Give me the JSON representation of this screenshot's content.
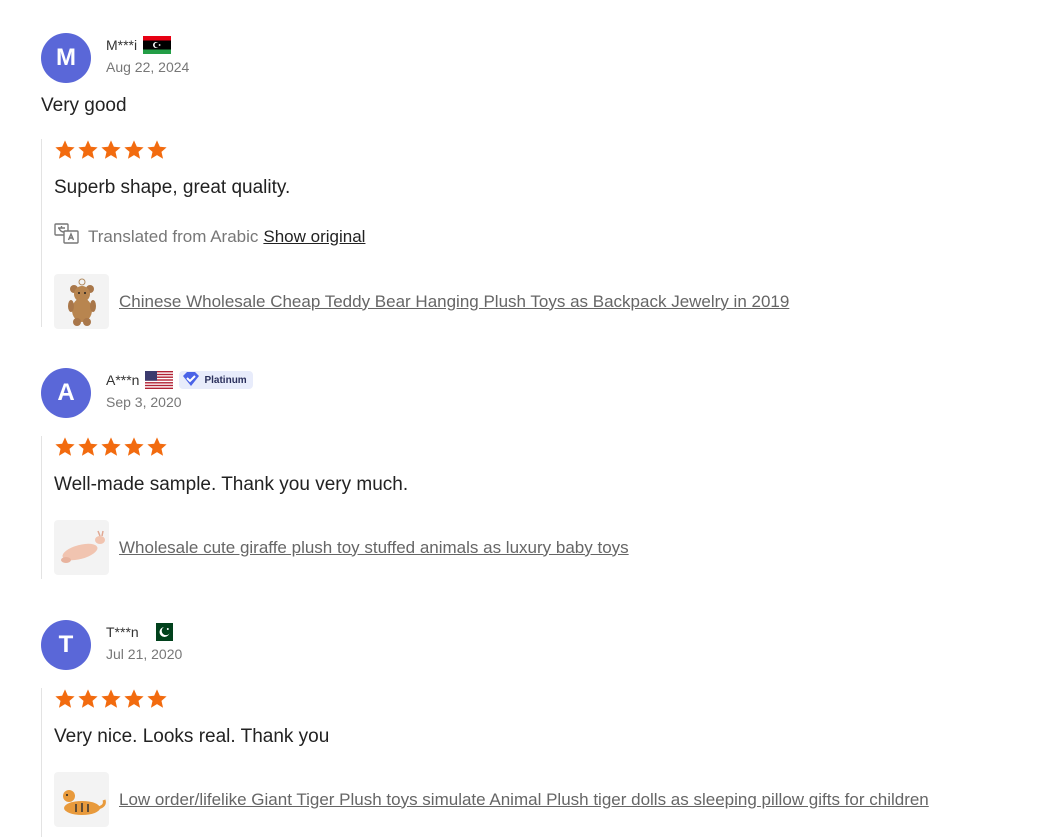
{
  "reviews": [
    {
      "initial": "M",
      "user": "M***i",
      "flag": "libya-flag",
      "date": "Aug 22, 2024",
      "title": "Very good",
      "rating": 5,
      "comment": "Superb shape, great quality.",
      "translated_text": "Translated from Arabic",
      "show_original": "Show original",
      "product": "Chinese Wholesale Cheap Teddy Bear Hanging Plush Toys as Backpack Jewelry in 2019",
      "product_icon": "teddy-bear-thumbnail"
    },
    {
      "initial": "A",
      "user": "A***n",
      "flag": "usa-flag",
      "badge": "Platinum",
      "date": "Sep 3, 2020",
      "rating": 5,
      "comment": "Well-made sample. Thank you very much.",
      "product": "Wholesale cute giraffe plush toy stuffed animals as luxury baby toys",
      "product_icon": "giraffe-plush-thumbnail"
    },
    {
      "initial": "T",
      "user": "T***n",
      "flag": "pakistan-flag",
      "date": "Jul 21, 2020",
      "rating": 5,
      "comment": "Very nice. Looks real. Thank you",
      "product": "Low order/lifelike Giant Tiger Plush toys simulate Animal Plush tiger dolls as sleeping pillow gifts for children",
      "product_icon": "tiger-plush-thumbnail"
    }
  ],
  "colors": {
    "star": "#f26b0f",
    "avatar": "#5a67d8"
  }
}
